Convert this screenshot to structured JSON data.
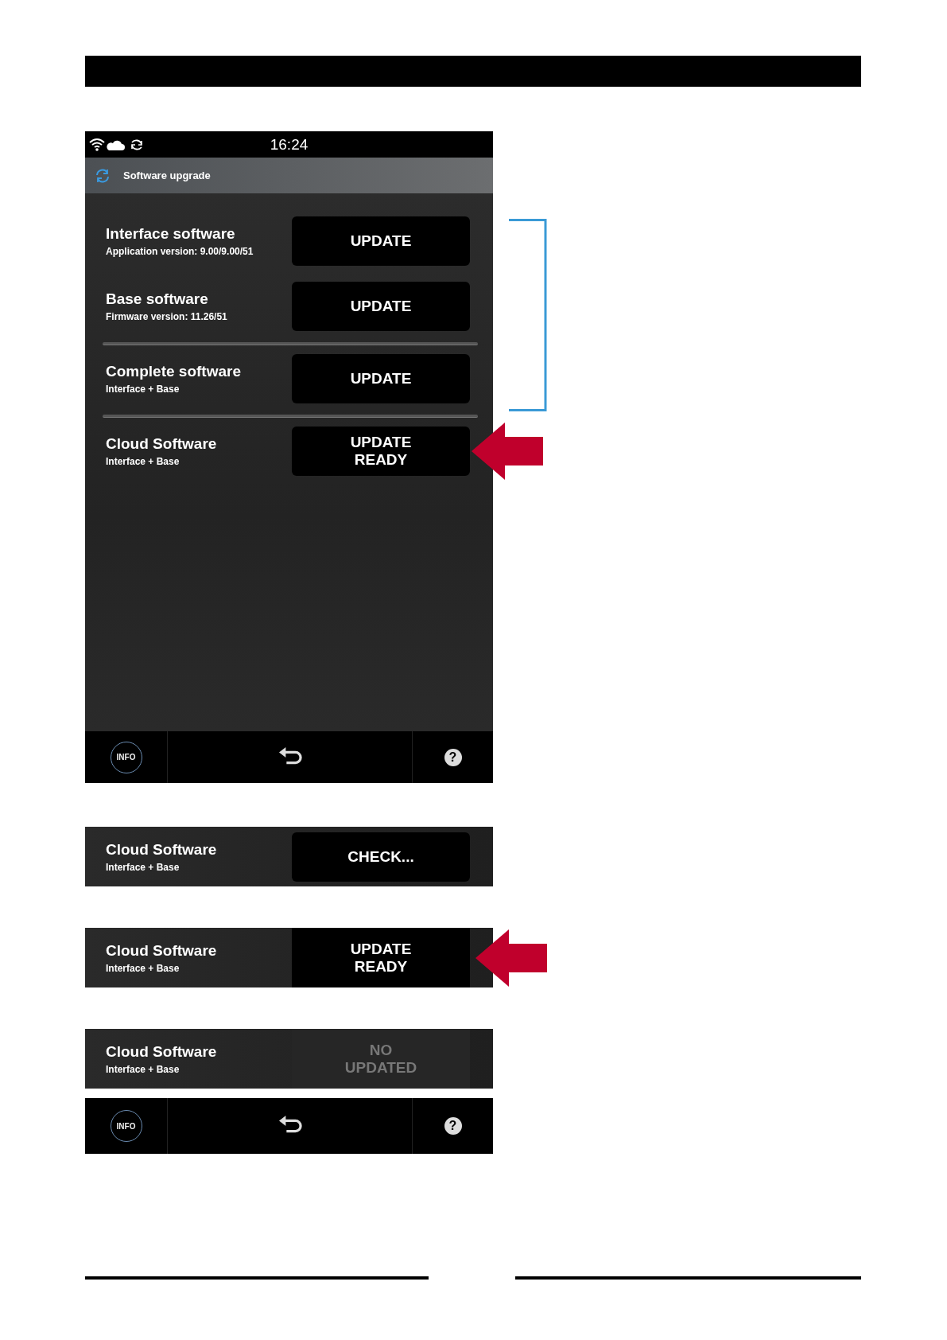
{
  "screen": {
    "status_bar": {
      "time": "16:24"
    },
    "title_bar": {
      "title": "Software upgrade"
    },
    "rows": [
      {
        "title": "Interface software",
        "subtitle": "Application version: 9.00/9.00/51",
        "button": "UPDATE",
        "disabled": false,
        "divider_after": false,
        "marked": false
      },
      {
        "title": "Base software",
        "subtitle": "Firmware version: 11.26/51",
        "button": "UPDATE",
        "disabled": false,
        "divider_after": true,
        "marked": false
      },
      {
        "title": "Complete software",
        "subtitle": "Interface + Base",
        "button": "UPDATE",
        "disabled": false,
        "divider_after": true,
        "marked": false
      },
      {
        "title": "Cloud Software",
        "subtitle": "Interface + Base",
        "button": "UPDATE READY",
        "disabled": false,
        "divider_after": false,
        "marked": true
      }
    ],
    "bottom_bar": {
      "info": "INFO",
      "help": "?"
    }
  },
  "snippets": [
    {
      "kind": "inset",
      "title": "Cloud Software",
      "subtitle": "Interface + Base",
      "button": "CHECK...",
      "disabled": false,
      "marked": false
    },
    {
      "kind": "full",
      "title": "Cloud Software",
      "subtitle": "Interface + Base",
      "button": "UPDATE READY",
      "disabled": false,
      "marked": true
    },
    {
      "kind": "full",
      "title": "Cloud Software",
      "subtitle": "Interface + Base",
      "button": "NO UPDATED",
      "disabled": true,
      "marked": false
    }
  ],
  "snippet_bottom_bar": {
    "info": "INFO",
    "help": "?"
  }
}
